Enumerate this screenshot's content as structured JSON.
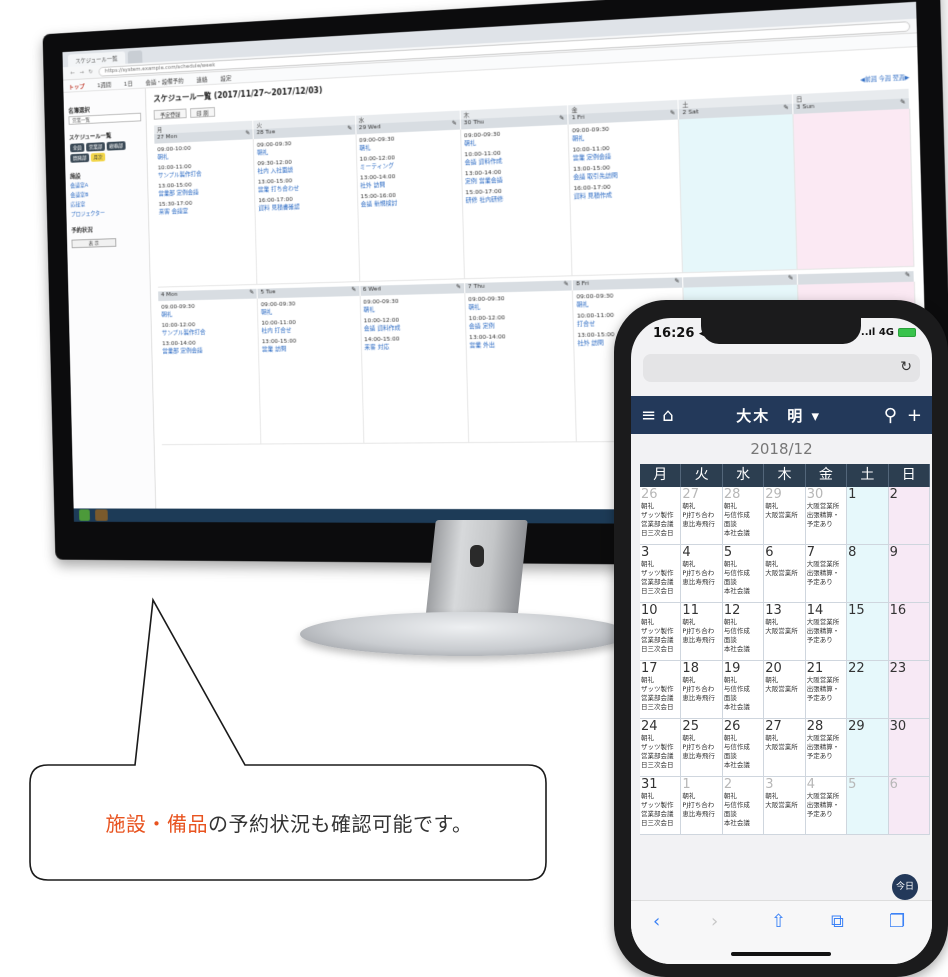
{
  "desktop": {
    "browser_tabs": [
      "スケジュール一覧",
      ""
    ],
    "url": "https://system.example.com/schedule/week",
    "menu": [
      "トップ",
      "1週間",
      "1日",
      "会議・設備予約",
      "連絡",
      "設定"
    ],
    "sidebar": {
      "section1": "名簿選択",
      "select_value": "営業一覧",
      "section2": "スケジュール一覧",
      "chips": [
        "全員",
        "営業部",
        "総務部",
        "開発部",
        "月次"
      ],
      "section3": "施設",
      "links": [
        "会議室A",
        "会議室B",
        "応接室",
        "プロジェクター"
      ],
      "section4": "予約状況",
      "button": "表 示"
    },
    "title": "スケジュール一覧 (2017/11/27～2017/12/03)",
    "toolbar": {
      "btn1": "予定登録",
      "btn2": "印 刷",
      "nav": "◀前週  今週  翌週▶"
    },
    "week1": {
      "dows": [
        "月",
        "火",
        "水",
        "木",
        "金",
        "土",
        "日"
      ],
      "dates": [
        "27 Mon",
        "28 Tue",
        "29 Wed",
        "30 Thu",
        "1 Fri",
        "2 Sat",
        "3 Sun"
      ],
      "cells": [
        [
          [
            "09:00-10:00",
            "朝礼"
          ],
          [
            "10:00-11:00",
            "サンプル製作打合"
          ],
          [
            "13:00-15:00",
            "営業部 定例会議"
          ],
          [
            "15:30-17:00",
            "来客 会議室"
          ]
        ],
        [
          [
            "09:00-09:30",
            "朝礼"
          ],
          [
            "09:30-12:00",
            "社内 入社面談"
          ],
          [
            "13:00-15:00",
            "営業 打ち合わせ"
          ],
          [
            "16:00-17:00",
            "資料 見積書確認"
          ]
        ],
        [
          [
            "09:00-09:30",
            "朝礼"
          ],
          [
            "10:00-12:00",
            "ミーティング"
          ],
          [
            "13:00-14:00",
            "社外 訪問"
          ],
          [
            "15:00-16:00",
            "会議 新規検討"
          ]
        ],
        [
          [
            "09:00-09:30",
            "朝礼"
          ],
          [
            "10:00-11:00",
            "会議 資料作成"
          ],
          [
            "13:00-14:00",
            "定例 営業会議"
          ],
          [
            "15:00-17:00",
            "研修 社内研修"
          ]
        ],
        [
          [
            "09:00-09:30",
            "朝礼"
          ],
          [
            "10:00-11:00",
            "営業 定例会議"
          ],
          [
            "13:00-15:00",
            "会議 取引先訪問"
          ],
          [
            "16:00-17:00",
            "資料 見積作成"
          ]
        ],
        [],
        []
      ]
    },
    "week2": {
      "dates": [
        "4 Mon",
        "5 Tue",
        "6 Wed",
        "7 Thu",
        "8 Fri",
        "",
        ""
      ],
      "cells": [
        [
          [
            "09:00-09:30",
            "朝礼"
          ],
          [
            "10:00-12:00",
            "サンプル製作打合"
          ],
          [
            "13:00-14:00",
            "営業部 定例会議"
          ]
        ],
        [
          [
            "09:00-09:30",
            "朝礼"
          ],
          [
            "10:00-11:00",
            "社内 打合せ"
          ],
          [
            "13:00-15:00",
            "営業 訪問"
          ]
        ],
        [
          [
            "09:00-09:30",
            "朝礼"
          ],
          [
            "10:00-12:00",
            "会議 資料作成"
          ],
          [
            "14:00-15:00",
            "来客 対応"
          ]
        ],
        [
          [
            "09:00-09:30",
            "朝礼"
          ],
          [
            "10:00-12:00",
            "会議 定例"
          ],
          [
            "13:00-14:00",
            "営業 外出"
          ]
        ],
        [
          [
            "09:00-09:30",
            "朝礼"
          ],
          [
            "10:00-11:00",
            "打合せ"
          ],
          [
            "13:00-15:00",
            "社外 訪問"
          ]
        ],
        [],
        []
      ]
    }
  },
  "callout": {
    "highlight1": "施設",
    "separator": "・",
    "highlight2": "備品",
    "rest": "の予約状況も確認可能です。",
    "highlight_color": "#e8531f"
  },
  "phone": {
    "status_time": "16:26 ◀",
    "status_signal": "..ıl 4G",
    "reload_icon": "reload-icon",
    "user_name": "大木　明 ▾",
    "month": "2018/12",
    "dows": [
      "月",
      "火",
      "水",
      "木",
      "金",
      "土",
      "日"
    ],
    "weeks": [
      [
        {
          "d": "26",
          "other": true,
          "ev": [
            "朝礼",
            "ザッツ製作",
            "営業部会議",
            "日三次会日"
          ]
        },
        {
          "d": "27",
          "other": true,
          "ev": [
            "朝礼",
            "PJ打ち合わ",
            "恵比寿飛行"
          ]
        },
        {
          "d": "28",
          "other": true,
          "ev": [
            "朝礼",
            "与信作成",
            "面談",
            "本社会議"
          ]
        },
        {
          "d": "29",
          "other": true,
          "ev": [
            "朝礼",
            "大阪営業所"
          ]
        },
        {
          "d": "30",
          "other": true,
          "ev": [
            "大阪営業所",
            "出張精算・",
            "予定あり"
          ]
        },
        {
          "d": "1",
          "other": false,
          "ev": []
        },
        {
          "d": "2",
          "other": false,
          "ev": []
        }
      ],
      [
        {
          "d": "3",
          "other": false,
          "ev": [
            "朝礼",
            "ザッツ製作",
            "営業部会議",
            "日三次会日"
          ]
        },
        {
          "d": "4",
          "other": false,
          "ev": [
            "朝礼",
            "PJ打ち合わ",
            "恵比寿飛行"
          ]
        },
        {
          "d": "5",
          "other": false,
          "ev": [
            "朝礼",
            "与信作成",
            "面談",
            "本社会議"
          ]
        },
        {
          "d": "6",
          "other": false,
          "ev": [
            "朝礼",
            "大阪営業所"
          ]
        },
        {
          "d": "7",
          "other": false,
          "ev": [
            "大阪営業所",
            "出張精算・",
            "予定あり"
          ]
        },
        {
          "d": "8",
          "other": false,
          "ev": []
        },
        {
          "d": "9",
          "other": false,
          "ev": []
        }
      ],
      [
        {
          "d": "10",
          "other": false,
          "ev": [
            "朝礼",
            "ザッツ製作",
            "営業部会議",
            "日三次会日"
          ]
        },
        {
          "d": "11",
          "other": false,
          "ev": [
            "朝礼",
            "PJ打ち合わ",
            "恵比寿飛行"
          ]
        },
        {
          "d": "12",
          "other": false,
          "ev": [
            "朝礼",
            "与信作成",
            "面談",
            "本社会議"
          ]
        },
        {
          "d": "13",
          "other": false,
          "ev": [
            "朝礼",
            "大阪営業所"
          ]
        },
        {
          "d": "14",
          "other": false,
          "ev": [
            "大阪営業所",
            "出張精算・",
            "予定あり"
          ]
        },
        {
          "d": "15",
          "other": false,
          "ev": []
        },
        {
          "d": "16",
          "other": false,
          "ev": []
        }
      ],
      [
        {
          "d": "17",
          "other": false,
          "ev": [
            "朝礼",
            "ザッツ製作",
            "営業部会議",
            "日三次会日"
          ]
        },
        {
          "d": "18",
          "other": false,
          "ev": [
            "朝礼",
            "PJ打ち合わ",
            "恵比寿飛行"
          ]
        },
        {
          "d": "19",
          "other": false,
          "ev": [
            "朝礼",
            "与信作成",
            "面談",
            "本社会議"
          ]
        },
        {
          "d": "20",
          "other": false,
          "ev": [
            "朝礼",
            "大阪営業所"
          ]
        },
        {
          "d": "21",
          "other": false,
          "ev": [
            "大阪営業所",
            "出張精算・",
            "予定あり"
          ]
        },
        {
          "d": "22",
          "other": false,
          "ev": []
        },
        {
          "d": "23",
          "other": false,
          "ev": []
        }
      ],
      [
        {
          "d": "24",
          "other": false,
          "ev": [
            "朝礼",
            "ザッツ製作",
            "営業部会議",
            "日三次会日"
          ]
        },
        {
          "d": "25",
          "other": false,
          "ev": [
            "朝礼",
            "PJ打ち合わ",
            "恵比寿飛行"
          ]
        },
        {
          "d": "26",
          "other": false,
          "ev": [
            "朝礼",
            "与信作成",
            "面談",
            "本社会議"
          ]
        },
        {
          "d": "27",
          "other": false,
          "ev": [
            "朝礼",
            "大阪営業所"
          ]
        },
        {
          "d": "28",
          "other": false,
          "ev": [
            "大阪営業所",
            "出張精算・",
            "予定あり"
          ]
        },
        {
          "d": "29",
          "other": false,
          "ev": []
        },
        {
          "d": "30",
          "other": false,
          "ev": []
        }
      ],
      [
        {
          "d": "31",
          "other": false,
          "ev": [
            "朝礼",
            "ザッツ製作",
            "営業部会議",
            "日三次会日"
          ]
        },
        {
          "d": "1",
          "other": true,
          "ev": [
            "朝礼",
            "PJ打ち合わ",
            "恵比寿飛行"
          ]
        },
        {
          "d": "2",
          "other": true,
          "ev": [
            "朝礼",
            "与信作成",
            "面談",
            "本社会議"
          ]
        },
        {
          "d": "3",
          "other": true,
          "ev": [
            "朝礼",
            "大阪営業所"
          ]
        },
        {
          "d": "4",
          "other": true,
          "ev": [
            "大阪営業所",
            "出張精算・",
            "予定あり"
          ]
        },
        {
          "d": "5",
          "other": true,
          "ev": []
        },
        {
          "d": "6",
          "other": true,
          "ev": []
        }
      ]
    ],
    "today_label": "今日",
    "safari": {
      "back": "‹",
      "forward": "›",
      "share": "⇧",
      "bookmarks": "⧉",
      "tabs": "❐"
    }
  }
}
